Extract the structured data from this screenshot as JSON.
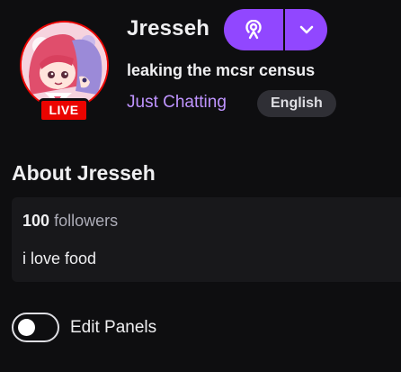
{
  "channel": {
    "name": "Jresseh",
    "live_badge": "LIVE",
    "stream_title": "leaking the mcsr census",
    "category": "Just Chatting",
    "language": "English"
  },
  "header_buttons": {
    "main_icon": "broadcast-icon",
    "dropdown_icon": "chevron-down-icon"
  },
  "about": {
    "heading": "About Jresseh",
    "followers_count": "100",
    "followers_label": "followers",
    "bio": "i love food"
  },
  "panels": {
    "toggle_label": "Edit Panels",
    "toggle_on": false
  },
  "colors": {
    "background": "#0e0e10",
    "accent": "#9147ff",
    "category_link": "#bf94ff",
    "live_red": "#eb0400",
    "card_bg": "#18181b",
    "tag_bg": "#2f2f35"
  }
}
